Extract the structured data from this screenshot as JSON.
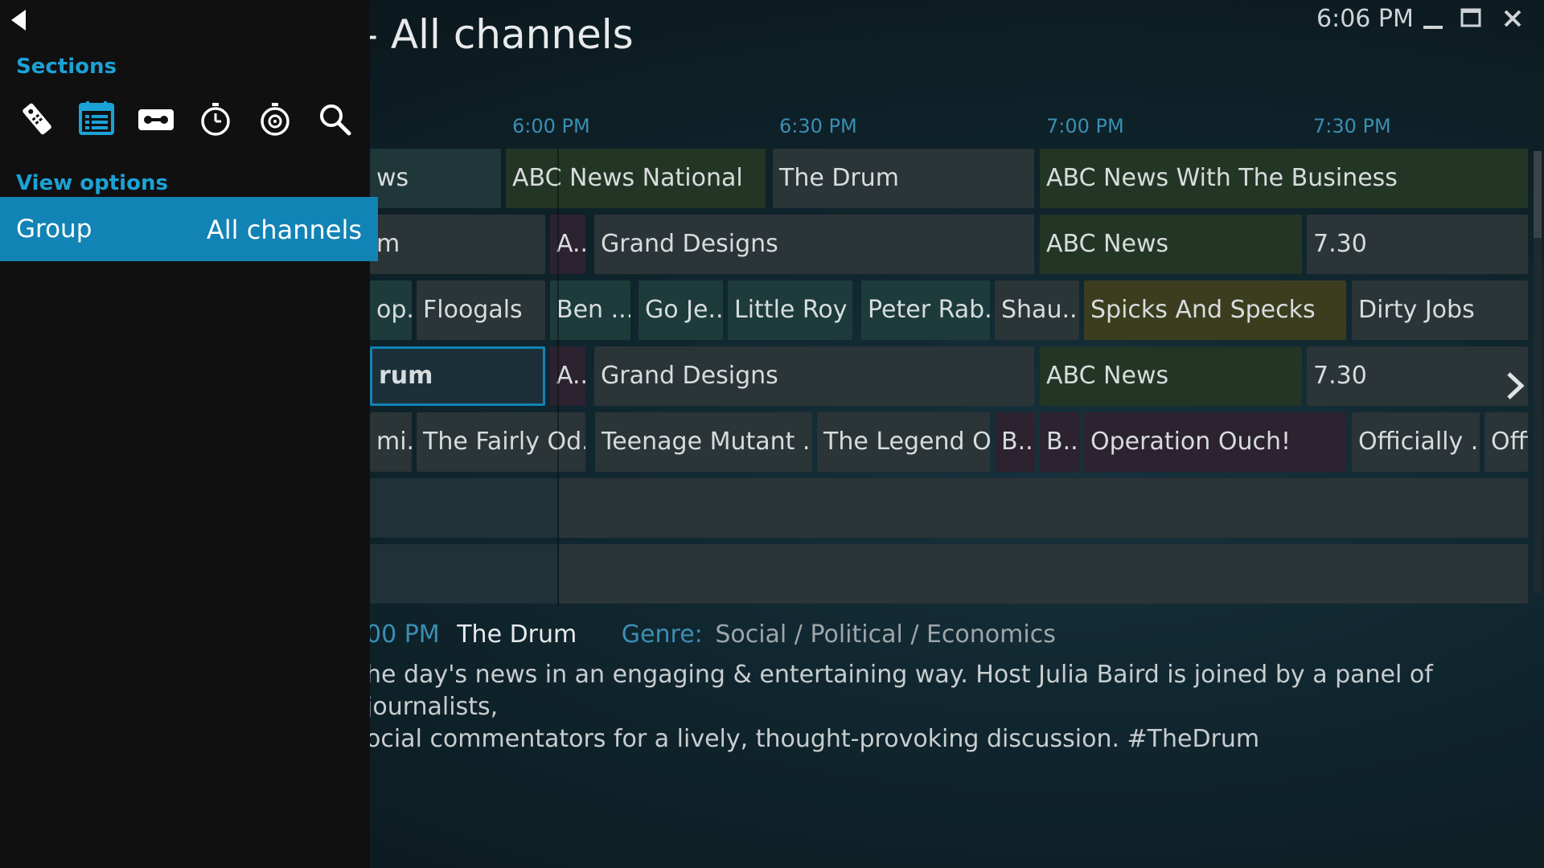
{
  "header": {
    "title": "- All channels",
    "clock": "6:06 PM"
  },
  "guide": {
    "times": [
      "6:00 PM",
      "6:30 PM",
      "7:00 PM",
      "7:30 PM"
    ],
    "rows": [
      {
        "cells": [
          {
            "title": "ws",
            "color": "#20373a"
          },
          {
            "title": "ABC News National",
            "color": "#233524"
          },
          {
            "title": "The Drum",
            "color": "#2b3437"
          },
          {
            "title": "ABC News With The Business",
            "color": "#233524"
          }
        ]
      },
      {
        "cells": [
          {
            "title": "m",
            "color": "#2b3437"
          },
          {
            "title": "A...",
            "color": "#2c2230"
          },
          {
            "title": "Grand Designs",
            "color": "#2b3437"
          },
          {
            "title": "ABC News",
            "color": "#233524"
          },
          {
            "title": "7.30",
            "color": "#2b3437"
          }
        ]
      },
      {
        "cells": [
          {
            "title": "op...",
            "color": "#1d3b3b"
          },
          {
            "title": "Floogals",
            "color": "#2b3437"
          },
          {
            "title": "Ben ...",
            "color": "#1d3b3b"
          },
          {
            "title": "Go Je...",
            "color": "#1d3b3b"
          },
          {
            "title": "Little Roy",
            "color": "#1d3b3b"
          },
          {
            "title": "Peter Rab...",
            "color": "#1d3b3b"
          },
          {
            "title": "Shau...",
            "color": "#2b3437"
          },
          {
            "title": "Spicks And Specks",
            "color": "#3b3d1e"
          },
          {
            "title": "Dirty Jobs",
            "color": "#2b3437"
          }
        ]
      },
      {
        "cells": [
          {
            "title": "rum",
            "color": "#1c3039"
          },
          {
            "title": "A...",
            "color": "#2c2230"
          },
          {
            "title": "Grand Designs",
            "color": "#2b3437"
          },
          {
            "title": "ABC News",
            "color": "#233524"
          },
          {
            "title": "7.30",
            "color": "#2b3437"
          }
        ]
      },
      {
        "cells": [
          {
            "title": "mi...",
            "color": "#2b3437"
          },
          {
            "title": "The Fairly Od...",
            "color": "#2b3437"
          },
          {
            "title": "Teenage Mutant ...",
            "color": "#2b3437"
          },
          {
            "title": "The Legend O...",
            "color": "#2b3437"
          },
          {
            "title": "B...",
            "color": "#2c2230"
          },
          {
            "title": "B...",
            "color": "#2c2230"
          },
          {
            "title": "Operation Ouch!",
            "color": "#2c2230"
          },
          {
            "title": "Officially ...",
            "color": "#2b3437"
          },
          {
            "title": "Offi",
            "color": "#2b3437"
          }
        ]
      },
      {
        "cells": [
          {
            "title": "",
            "color": "#203238"
          },
          {
            "title": "",
            "color": "#2b3437"
          }
        ]
      },
      {
        "cells": [
          {
            "title": "",
            "color": "#203238"
          },
          {
            "title": "",
            "color": "#2b3437"
          }
        ]
      }
    ]
  },
  "info": {
    "time": "00 PM",
    "title": "The Drum",
    "genre_label": "Genre:",
    "genre": "Social / Political / Economics",
    "description_line1": "he day's news in an engaging & entertaining way. Host Julia Baird is joined by a panel of journalists,",
    "description_line2": "ocial commentators for a lively, thought-provoking discussion. #TheDrum"
  },
  "side_panel": {
    "sections_heading": "Sections",
    "section_icons": [
      "remote-icon",
      "guide-icon",
      "recordings-icon",
      "timers-icon",
      "timer-rules-icon",
      "search-icon"
    ],
    "view_options_heading": "View options",
    "group_label": "Group",
    "group_value": "All channels"
  },
  "colors": {
    "accent": "#1ba2d6",
    "selected_bg": "#1283b5",
    "time_label": "#3a8fb3"
  }
}
